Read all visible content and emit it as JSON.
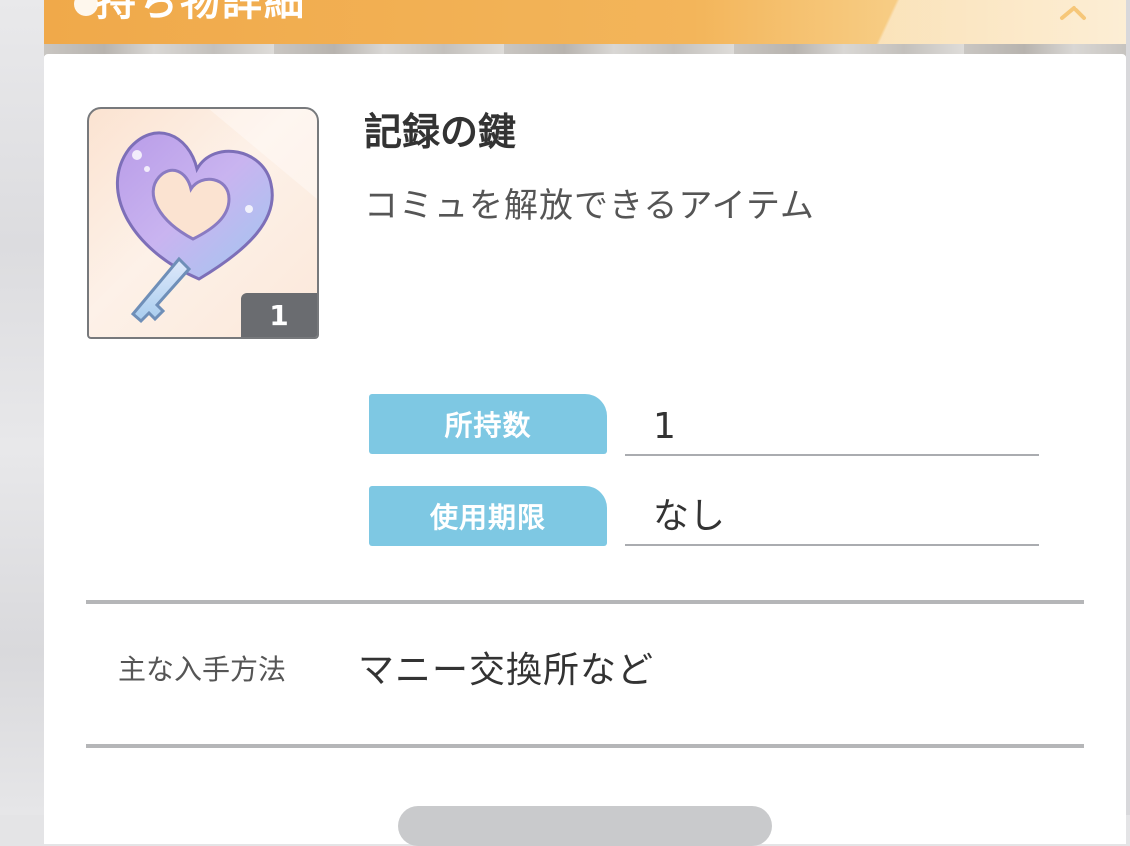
{
  "header": {
    "title": "持ち物詳細",
    "accent_color": "#f0a94a"
  },
  "item": {
    "name": "記録の鍵",
    "description": "コミュを解放できるアイテム",
    "icon": "heart-key-icon",
    "count_badge": "1"
  },
  "details": {
    "owned_label": "所持数",
    "owned_value": "1",
    "expiry_label": "使用期限",
    "expiry_value": "なし",
    "tag_color": "#7ec8e3"
  },
  "obtain": {
    "label": "主な入手方法",
    "value": "マニー交換所など"
  }
}
